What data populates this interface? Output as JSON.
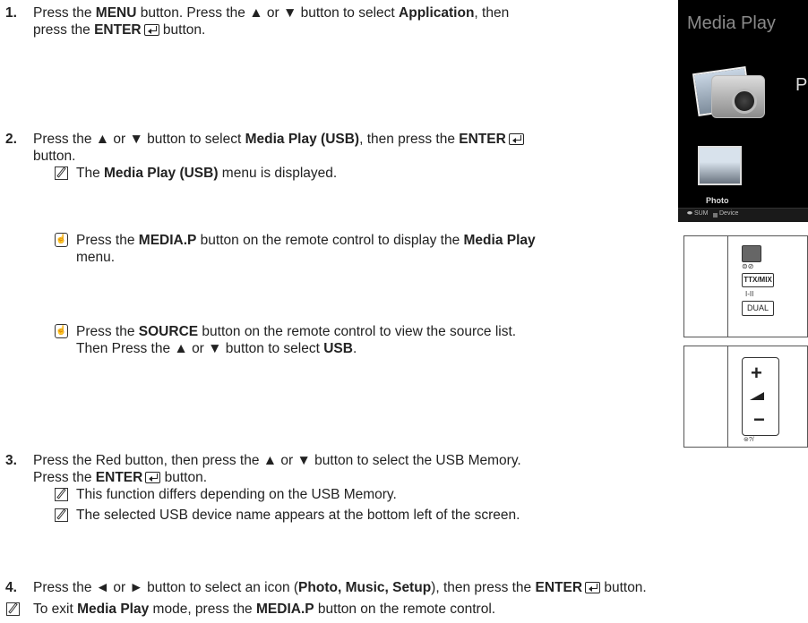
{
  "step1": {
    "num": "1.",
    "l1a": "Press the ",
    "l1b": "MENU",
    "l1c": " button. Press the ▲ or ▼ button to select ",
    "l1d": "Application",
    "l1e": ", then",
    "l2a": "press the ",
    "l2b": "ENTER",
    "l2c": " button."
  },
  "step2": {
    "num": "2.",
    "l1a": "Press the ▲ or ▼ button to select ",
    "l1b": "Media Play (USB)",
    "l1c": ", then press the ",
    "l1d": "ENTER",
    "l2": "button.",
    "note1a": "The ",
    "note1b": "Media Play (USB)",
    "note1c": " menu is displayed.",
    "tipA1a": "Press the ",
    "tipA1b": "MEDIA.P",
    "tipA1c": " button on the remote control to display the ",
    "tipA1d": "Media Play",
    "tipA2": "menu.",
    "tipB1a": "Press the ",
    "tipB1b": "SOURCE",
    "tipB1c": " button on the remote control to view the source list.",
    "tipB2a": "Then Press the ▲ or ▼ button to select ",
    "tipB2b": "USB",
    "tipB2c": "."
  },
  "step3": {
    "num": "3.",
    "l1": "Press the Red button, then press the ▲ or ▼ button to select the USB Memory.",
    "l2a": "Press the ",
    "l2b": "ENTER",
    "l2c": " button.",
    "note1": "This function differs depending on the USB Memory.",
    "note2": "The selected USB device name appears at the bottom left of the screen."
  },
  "step4": {
    "num": "4.",
    "l1a": "Press the ◄ or ► button to select an icon (",
    "l1b": "Photo, Music, Setup",
    "l1c": "), then press the ",
    "l1d": "ENTER",
    "l1e": " button."
  },
  "final_note": {
    "a": "To exit ",
    "b": "Media Play",
    "c": " mode, press the ",
    "d": "MEDIA.P",
    "e": " button on the remote control."
  },
  "tv_screen": {
    "title": "Media Play",
    "big_label": "P",
    "icon_label": "Photo",
    "footer_sum": "SUM",
    "footer_device": "Device"
  },
  "remote1": {
    "icons": "⊜⊘",
    "ttx": "TTX/MIX",
    "h": "I-II",
    "dual": "DUAL"
  },
  "remote2": {
    "plus": "+",
    "minus": "−",
    "sub": "⊜?/"
  }
}
